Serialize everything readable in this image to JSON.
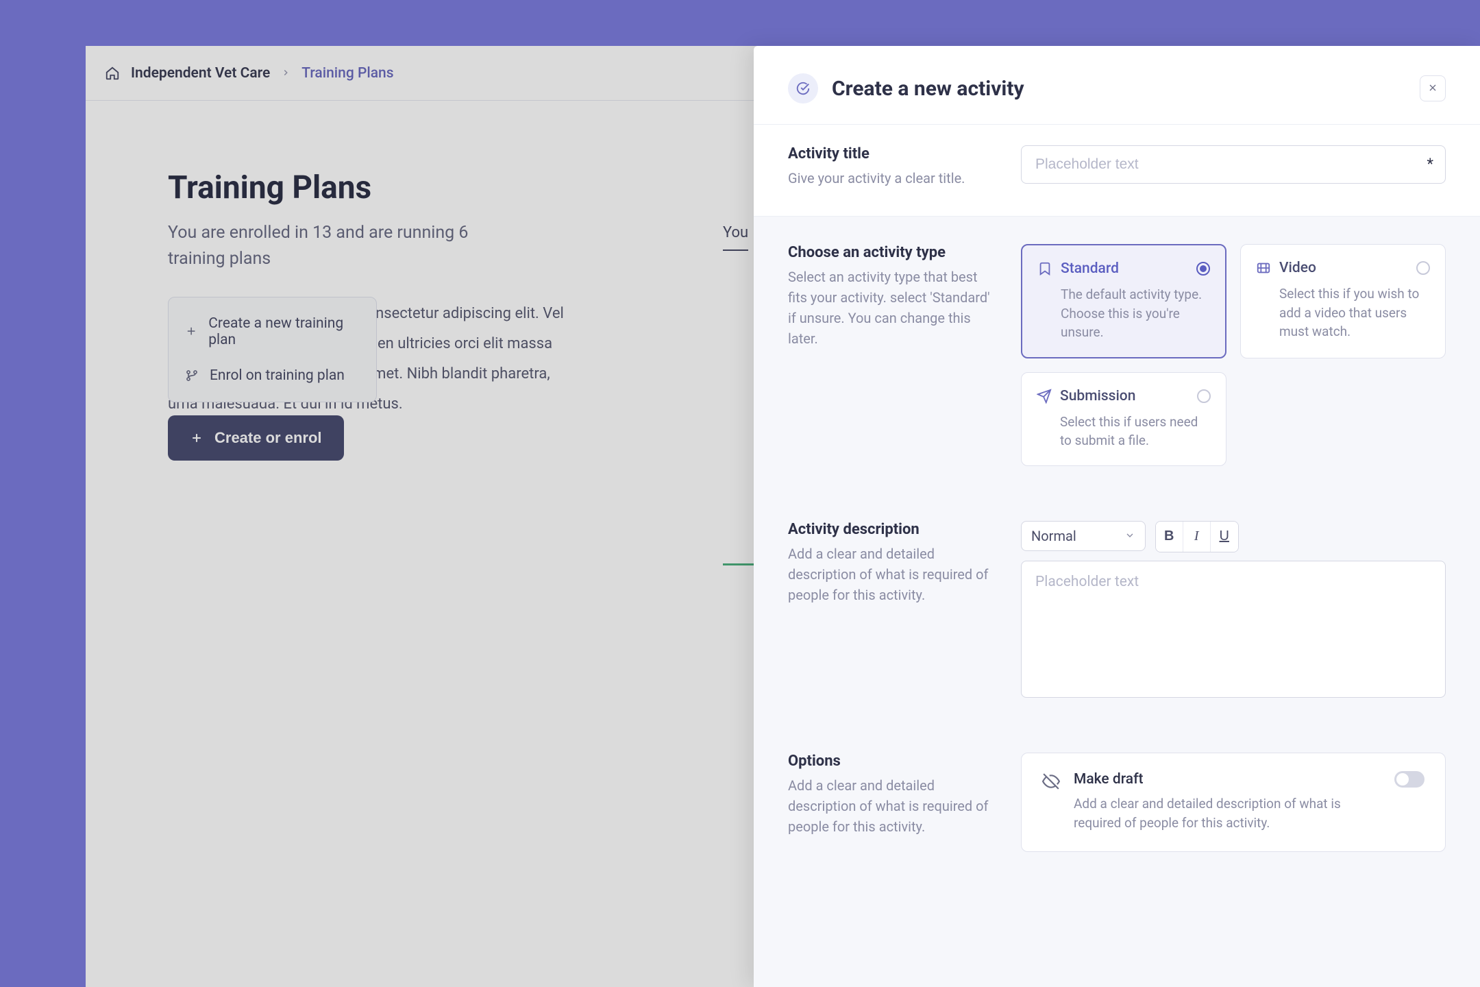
{
  "breadcrumb": {
    "root": "Independent Vet Care",
    "current": "Training Plans"
  },
  "page": {
    "title": "Training Plans",
    "subtitle": "You are enrolled in 13 and are running 6 training plans",
    "description": "Lorem ipsum dolor sit amet, consectetur adipiscing elit. Vel pellentesque iaculis ipsum sapien ultricies orci elit massa lectus. Diam, orci posuere sit amet. Nibh blandit pharetra, urna malesuada. Et dui in id metus."
  },
  "tabs": {
    "first_partial": "You"
  },
  "popover": {
    "create_plan": "Create a new training plan",
    "enrol_plan": "Enrol on training plan"
  },
  "create_button": "Create or enrol",
  "panel": {
    "title": "Create a new activity",
    "activity_title": {
      "label": "Activity title",
      "help": "Give your activity a clear title.",
      "placeholder": "Placeholder text"
    },
    "activity_type": {
      "label": "Choose an activity type",
      "help": "Select an activity type that best fits your activity. select 'Standard' if unsure. You can change this later.",
      "options": [
        {
          "title": "Standard",
          "desc": "The default activity type. Choose this is you're unsure.",
          "selected": true
        },
        {
          "title": "Video",
          "desc": "Select this if you wish to add a video that users must watch.",
          "selected": false
        },
        {
          "title": "Submission",
          "desc": "Select this if users need to submit a file.",
          "selected": false
        }
      ]
    },
    "description": {
      "label": "Activity description",
      "help": "Add a clear and detailed description of what is required of people for this activity.",
      "format_select": "Normal",
      "placeholder": "Placeholder text"
    },
    "options": {
      "label": "Options",
      "help": "Add a clear and detailed description of what is required of people for this activity.",
      "draft": {
        "title": "Make draft",
        "desc": "Add a clear and detailed description of what is required of people for this activity."
      }
    }
  }
}
